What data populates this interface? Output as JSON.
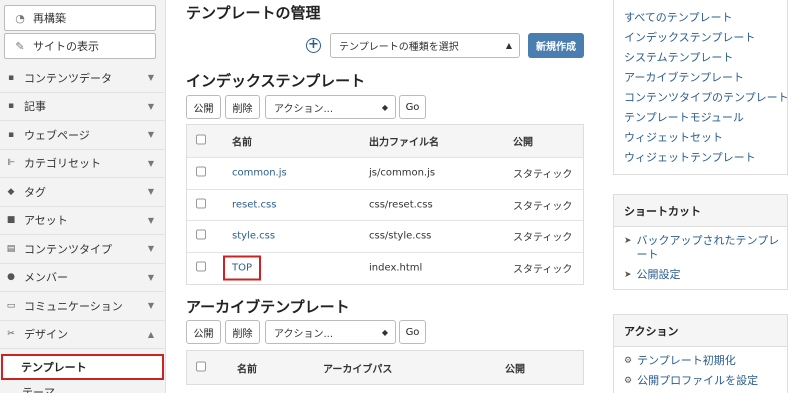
{
  "sidebar": {
    "rebuild_label": "再構築",
    "view_site_label": "サイトの表示",
    "menu": [
      {
        "label": "コンテンツデータ",
        "icon": "▪"
      },
      {
        "label": "記事",
        "icon": "▪"
      },
      {
        "label": "ウェブページ",
        "icon": "▪"
      },
      {
        "label": "カテゴリセット",
        "icon": "⊩"
      },
      {
        "label": "タグ",
        "icon": "◆"
      },
      {
        "label": "アセット",
        "icon": "■"
      },
      {
        "label": "コンテンツタイプ",
        "icon": "▤"
      },
      {
        "label": "メンバー",
        "icon": "●"
      },
      {
        "label": "コミュニケーション",
        "icon": "▭"
      },
      {
        "label": "デザイン",
        "icon": "✂"
      }
    ],
    "submenu_active": "テンプレート",
    "submenu_next": "テーマ"
  },
  "page": {
    "title": "テンプレートの管理",
    "type_select": "テンプレートの種類を選択",
    "new_button": "新規作成"
  },
  "index_section": {
    "title": "インデックステンプレート",
    "publish": "公開",
    "delete": "削除",
    "action_select": "アクション...",
    "go": "Go",
    "headers": {
      "name": "名前",
      "output": "出力ファイル名",
      "publish": "公開"
    },
    "rows": [
      {
        "name": "common.js",
        "output": "js/common.js",
        "publish": "スタティック"
      },
      {
        "name": "reset.css",
        "output": "css/reset.css",
        "publish": "スタティック"
      },
      {
        "name": "style.css",
        "output": "css/style.css",
        "publish": "スタティック"
      },
      {
        "name": "TOP",
        "output": "index.html",
        "publish": "スタティック"
      }
    ]
  },
  "archive_section": {
    "title": "アーカイブテンプレート",
    "publish": "公開",
    "delete": "削除",
    "action_select": "アクション...",
    "go": "Go",
    "headers": {
      "name": "名前",
      "path": "アーカイブパス",
      "publish": "公開"
    }
  },
  "right": {
    "links": [
      "すべてのテンプレート",
      "インデックステンプレート",
      "システムテンプレート",
      "アーカイブテンプレート",
      "コンテンツタイプのテンプレート",
      "テンプレートモジュール",
      "ウィジェットセット",
      "ウィジェットテンプレート"
    ],
    "shortcut_title": "ショートカット",
    "shortcut_backup": "バックアップされたテンプレート",
    "shortcut_publish": "公開設定",
    "action_title": "アクション",
    "action_init": "テンプレート初期化",
    "action_profile": "公開プロファイルを設定"
  },
  "colors": {
    "accent": "#4a7eb0",
    "link": "#2a5d8f",
    "highlight": "#cc2222"
  }
}
